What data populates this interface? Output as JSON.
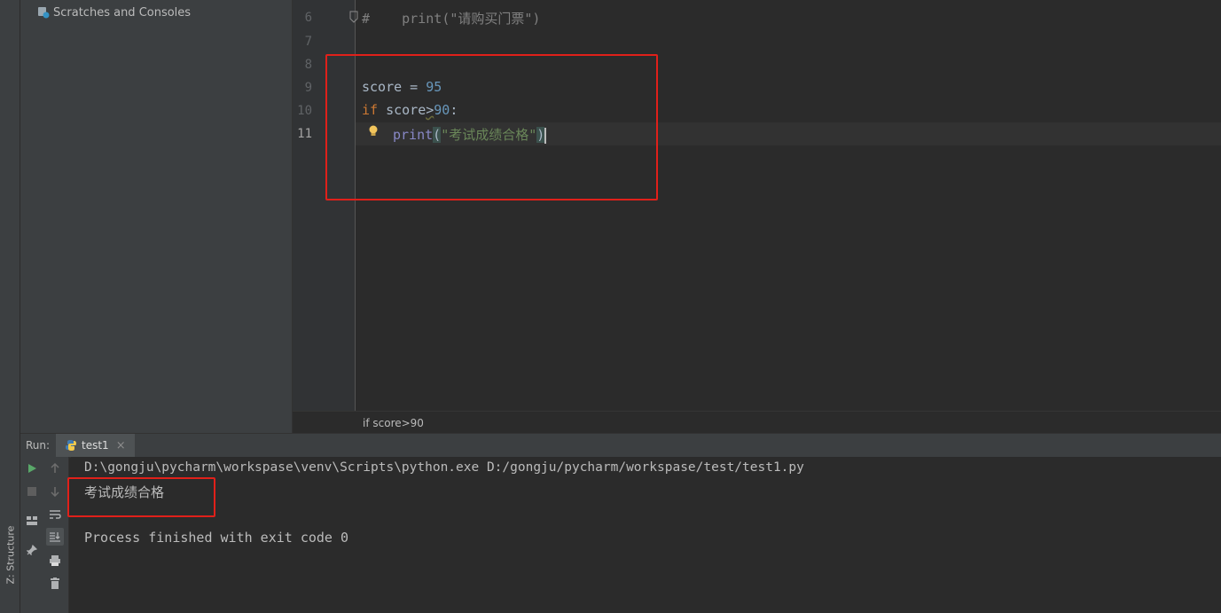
{
  "project_panel": {
    "scratches_label": "Scratches and Consoles"
  },
  "side_strip": {
    "structure_tab": "Z: Structure"
  },
  "editor": {
    "line_numbers": [
      "6",
      "7",
      "8",
      "9",
      "10",
      "11"
    ],
    "current_line": "11",
    "lines": {
      "l6": {
        "comment": "#",
        "builtin": "print",
        "text": "(\"请购买门票\")"
      },
      "l9": {
        "var": "score",
        "op": " = ",
        "num": "95"
      },
      "l10": {
        "kw": "if",
        "var": " score",
        "op": ">",
        "num": "90",
        "colon": ":"
      },
      "l11": {
        "builtin": "print",
        "open": "(",
        "str": "\"考试成绩合格\"",
        "close": ")"
      }
    },
    "intention_icon": "lightbulb-icon"
  },
  "breadcrumb": "if score>90",
  "run_panel": {
    "label": "Run:",
    "tab_name": "test1",
    "tab_icon": "python-icon",
    "console": {
      "command": "D:\\gongju\\pycharm\\workspase\\venv\\Scripts\\python.exe D:/gongju/pycharm/workspase/test/test1.py",
      "output": "考试成绩合格",
      "exit_message": "Process finished with exit code 0"
    }
  },
  "colors": {
    "editor_bg": "#2b2b2b",
    "panel_bg": "#3c3f41",
    "keyword": "#cc7832",
    "number": "#6897bb",
    "string": "#6a8759",
    "builtin": "#8888c6",
    "highlight_box": "#e0201a"
  }
}
